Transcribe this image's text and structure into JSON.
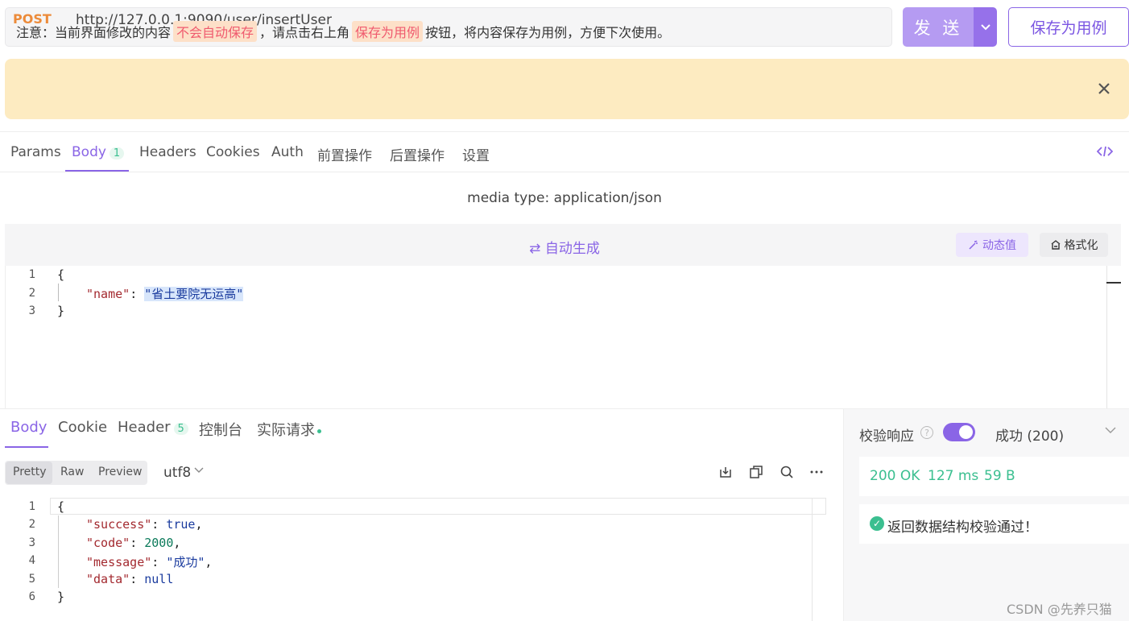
{
  "request": {
    "method": "POST",
    "url": "http://127.0.0.1:9090/user/insertUser",
    "send_label": "发 送",
    "save_label": "保存为用例"
  },
  "notice": {
    "prefix": "注意：当前界面修改的内容",
    "highlight1": "不会自动保存",
    "middle": "，请点击右上角",
    "highlight2": "保存为用例",
    "suffix": "按钮，将内容保存为用例，方便下次使用。"
  },
  "req_tabs": [
    {
      "label": "Params"
    },
    {
      "label": "Body",
      "badge": "1"
    },
    {
      "label": "Headers"
    },
    {
      "label": "Cookies"
    },
    {
      "label": "Auth"
    },
    {
      "label": "前置操作"
    },
    {
      "label": "后置操作"
    },
    {
      "label": "设置"
    }
  ],
  "media_type": "media type: application/json",
  "editor": {
    "autogen_label": "⇄ 自动生成",
    "dynamic_label": "动态值",
    "format_label": "格式化",
    "line_numbers": [
      "1",
      "2",
      "3"
    ],
    "open_brace": "{",
    "key": "\"name\"",
    "colon": ": ",
    "value": "\"省土要院无运高\"",
    "close_brace": "}"
  },
  "resp_tabs": [
    {
      "label": "Body"
    },
    {
      "label": "Cookie"
    },
    {
      "label": "Header",
      "badge": "5"
    },
    {
      "label": "控制台"
    },
    {
      "label": "实际请求"
    }
  ],
  "resp_toolbar": {
    "modes": [
      "Pretty",
      "Raw",
      "Preview"
    ],
    "encoding": "utf8"
  },
  "response": {
    "line_numbers": [
      "1",
      "2",
      "3",
      "4",
      "5",
      "6"
    ],
    "open_brace": "{",
    "lines": [
      {
        "key": "\"success\"",
        "value": "true",
        "trail": ","
      },
      {
        "key": "\"code\"",
        "value": "2000",
        "trail": ","
      },
      {
        "key": "\"message\"",
        "value": "\"成功\"",
        "trail": ","
      },
      {
        "key": "\"data\"",
        "value": "null",
        "trail": ""
      }
    ],
    "close_brace": "}"
  },
  "validation": {
    "label": "校验响应",
    "toggle_on": true,
    "status": "成功 (200)",
    "code": "200 OK",
    "time": "127 ms",
    "size": "59 B",
    "result": "返回数据结构校验通过！"
  },
  "watermark": "CSDN @先养只猫",
  "colors": {
    "accent": "#8a65e6",
    "success": "#3bbf90",
    "method": "#ec8b3a",
    "notice_bg": "#fdebc1"
  }
}
